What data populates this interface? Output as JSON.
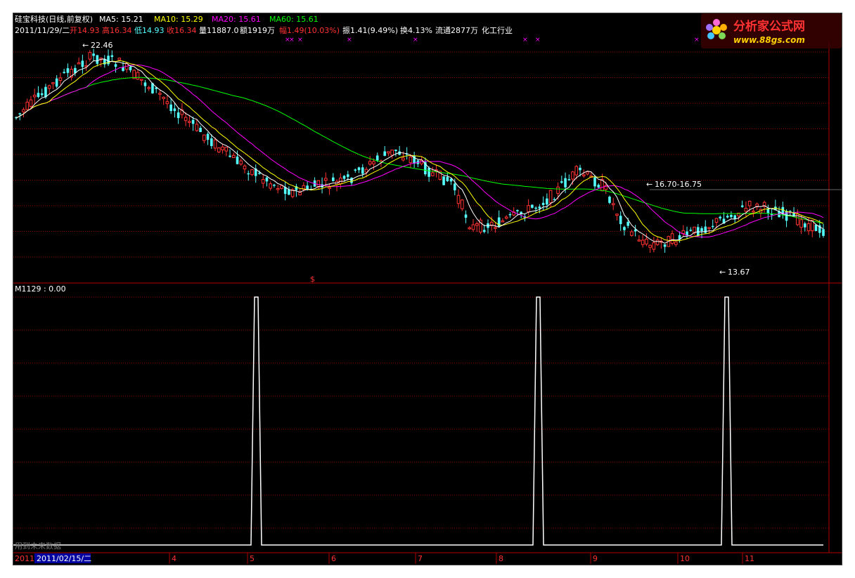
{
  "watermark": {
    "brand_text": "分析家公式网",
    "url_text": "www.88gs.com"
  },
  "header": {
    "stock_title": "硅宝科技(日线,前复权)",
    "ma5": "MA5: 15.21",
    "ma10": "MA10: 15.29",
    "ma20": "MA20: 15.61",
    "ma60": "MA60: 15.61",
    "date": "2011/11/29/二",
    "open": "开14.93",
    "high": "高16.34",
    "low": "低14.93",
    "close": "收16.34",
    "volume": "量11887.0",
    "amount": "额1919万",
    "change": "幅1.49(10.03%)",
    "amplitude": "振1.41(9.49%)",
    "turnover": "换4.13%",
    "float_shares": "流通2877万",
    "industry": "化工行业"
  },
  "annotations": {
    "high_label": "22.46",
    "range_label": "16.70-16.75",
    "low_label": "13.67",
    "dollar_mark": "$"
  },
  "indicator": {
    "title": "M1129 : 0.00",
    "future_data_note": "用到未来数据"
  },
  "axis": {
    "year": "2011",
    "cursor_date": "2011/02/15/二",
    "months": [
      "4",
      "5",
      "6",
      "7",
      "8",
      "9",
      "10",
      "11"
    ]
  },
  "colors": {
    "up": "#ff3232",
    "down": "#54ffff",
    "ma5": "#ffffff",
    "ma10": "#ffff00",
    "ma20": "#ff00ff",
    "ma60": "#00ff00",
    "grid": "#8b0000"
  },
  "chart_data": {
    "type": "line",
    "title": "M1129",
    "x_positions": "trading days Jan–Nov 2011",
    "series": [
      {
        "name": "M1129",
        "spikes_at_month": [
          "5",
          "8",
          "10"
        ],
        "values": [
          0,
          1,
          0,
          1,
          0,
          1,
          0
        ]
      }
    ],
    "price_extremes": {
      "high": 22.46,
      "low": 13.67,
      "last_close": 16.34
    }
  }
}
